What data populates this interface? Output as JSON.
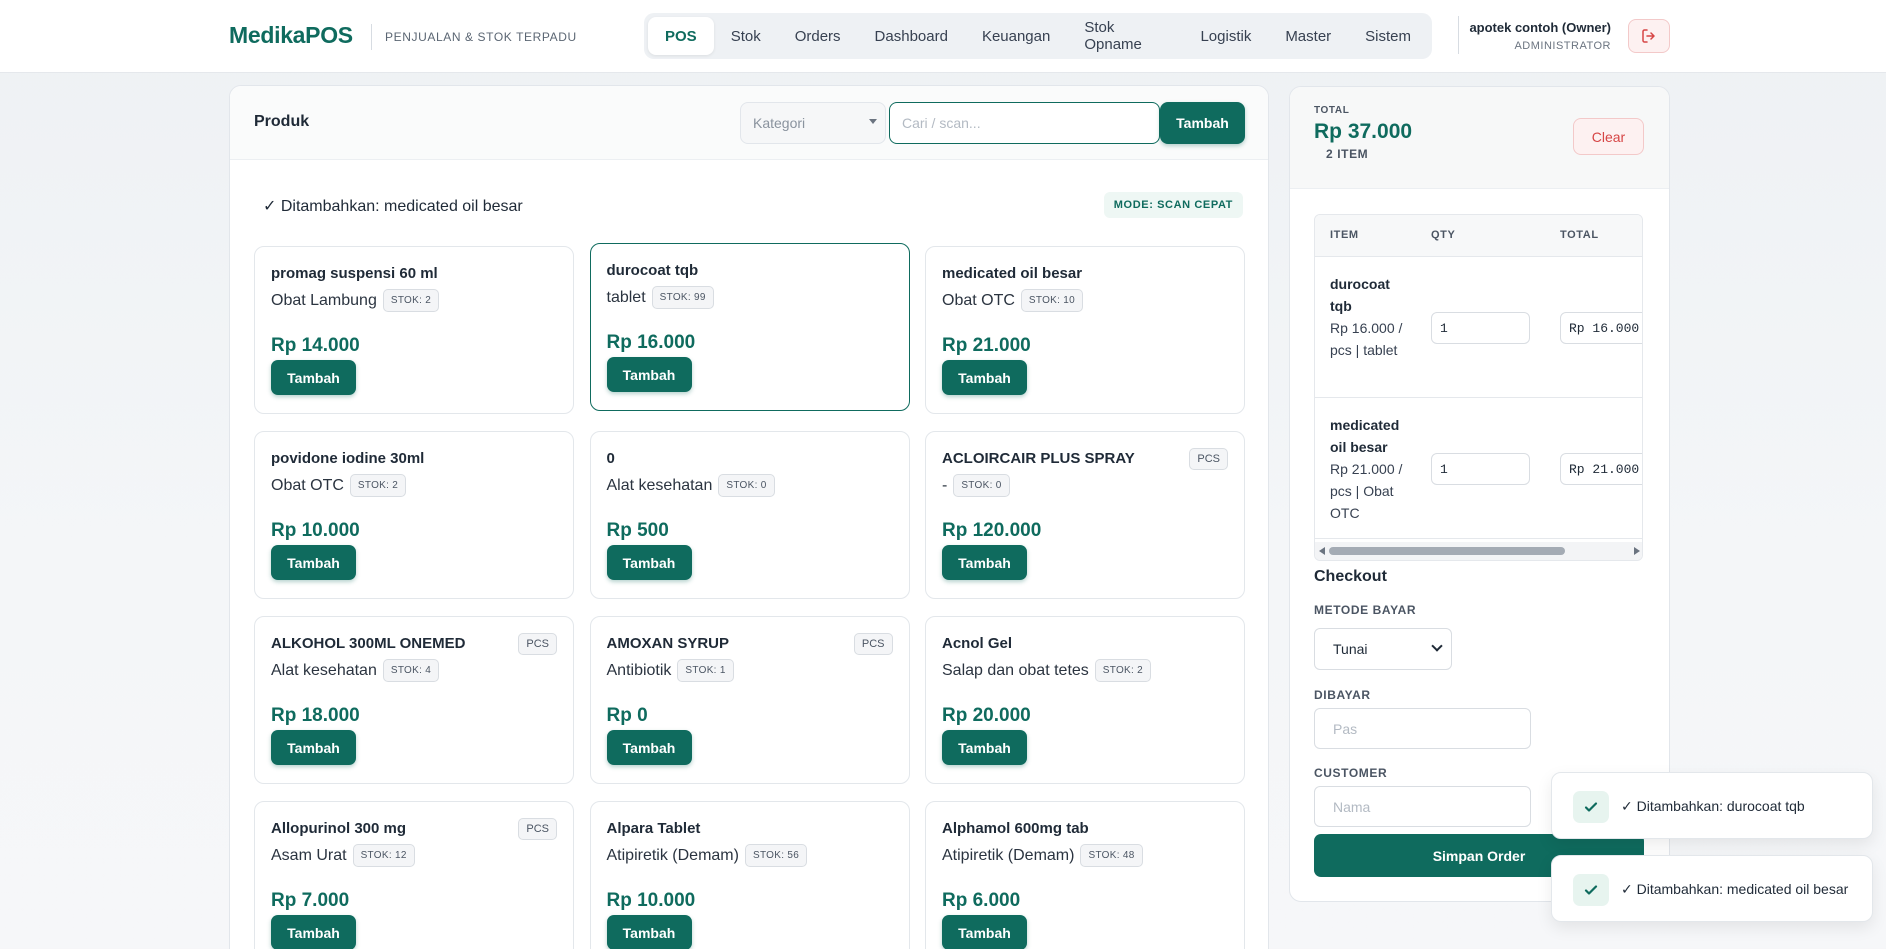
{
  "header": {
    "brand": "MedikaPOS",
    "tagline": "PENJUALAN & STOK TERPADU",
    "nav": [
      "POS",
      "Stok",
      "Orders",
      "Dashboard",
      "Keuangan",
      "Stok Opname",
      "Logistik",
      "Master",
      "Sistem"
    ],
    "active_nav": "POS",
    "user_name": "apotek contoh (Owner)",
    "user_role": "ADMINISTRATOR",
    "logout_icon": "logout-icon"
  },
  "products_panel": {
    "title": "Produk",
    "category_placeholder": "Kategori",
    "search_placeholder": "Cari / scan...",
    "search_button": "Tambah",
    "added_message": "✓ Ditambahkan: medicated oil besar",
    "mode_badge": "MODE: SCAN CEPAT",
    "add_label": "Tambah",
    "products": [
      {
        "name": "promag suspensi 60 ml",
        "category": "Obat Lambung",
        "stock": "STOK: 2",
        "unit": "",
        "price": "Rp 14.000",
        "selected": false
      },
      {
        "name": "durocoat tqb",
        "category": "tablet",
        "stock": "STOK: 99",
        "unit": "",
        "price": "Rp 16.000",
        "selected": true
      },
      {
        "name": "medicated oil besar",
        "category": "Obat OTC",
        "stock": "STOK: 10",
        "unit": "",
        "price": "Rp 21.000",
        "selected": false
      },
      {
        "name": "povidone iodine 30ml",
        "category": "Obat OTC",
        "stock": "STOK: 2",
        "unit": "",
        "price": "Rp 10.000",
        "selected": false
      },
      {
        "name": "0",
        "category": "Alat kesehatan",
        "stock": "STOK: 0",
        "unit": "",
        "price": "Rp 500",
        "selected": false
      },
      {
        "name": "ACLOIRCAIR PLUS SPRAY",
        "category": "-",
        "stock": "STOK: 0",
        "unit": "PCS",
        "price": "Rp 120.000",
        "selected": false
      },
      {
        "name": "ALKOHOL 300ML ONEMED",
        "category": "Alat kesehatan",
        "stock": "STOK: 4",
        "unit": "PCS",
        "price": "Rp 18.000",
        "selected": false
      },
      {
        "name": "AMOXAN SYRUP",
        "category": "Antibiotik",
        "stock": "STOK: 1",
        "unit": "PCS",
        "price": "Rp 0",
        "selected": false
      },
      {
        "name": "Acnol Gel",
        "category": "Salap dan obat tetes",
        "stock": "STOK: 2",
        "unit": "",
        "price": "Rp 20.000",
        "selected": false
      },
      {
        "name": "Allopurinol 300 mg",
        "category": "Asam Urat",
        "stock": "STOK: 12",
        "unit": "PCS",
        "price": "Rp 7.000",
        "selected": false
      },
      {
        "name": "Alpara Tablet",
        "category": "Atipiretik (Demam)",
        "stock": "STOK: 56",
        "unit": "",
        "price": "Rp 10.000",
        "selected": false
      },
      {
        "name": "Alphamol 600mg tab",
        "category": "Atipiretik (Demam)",
        "stock": "STOK: 48",
        "unit": "",
        "price": "Rp 6.000",
        "selected": false
      }
    ]
  },
  "cart": {
    "total_label": "TOTAL",
    "total_value": "Rp 37.000",
    "item_count": "2 ITEM",
    "clear_label": "Clear",
    "columns": [
      "ITEM",
      "QTY",
      "TOTAL"
    ],
    "rows": [
      {
        "name": "durocoat tqb",
        "meta": "Rp 16.000 / pcs | tablet",
        "qty": "1",
        "line_total": "Rp 16.000"
      },
      {
        "name": "medicated oil besar",
        "meta": "Rp 21.000 / pcs | Obat OTC",
        "qty": "1",
        "line_total": "Rp 21.000"
      }
    ],
    "checkout_title": "Checkout",
    "payment_label": "METODE BAYAR",
    "payment_value": "Tunai",
    "paid_label": "DIBAYAR",
    "paid_placeholder": "Pas",
    "customer_label": "CUSTOMER",
    "customer_placeholder": "Nama",
    "save_label": "Simpan Order"
  },
  "toasts": [
    "✓ Ditambahkan: durocoat tqb",
    "✓ Ditambahkan: medicated oil besar"
  ],
  "colors": {
    "accent": "#0f6b5e",
    "danger": "#d64545"
  }
}
